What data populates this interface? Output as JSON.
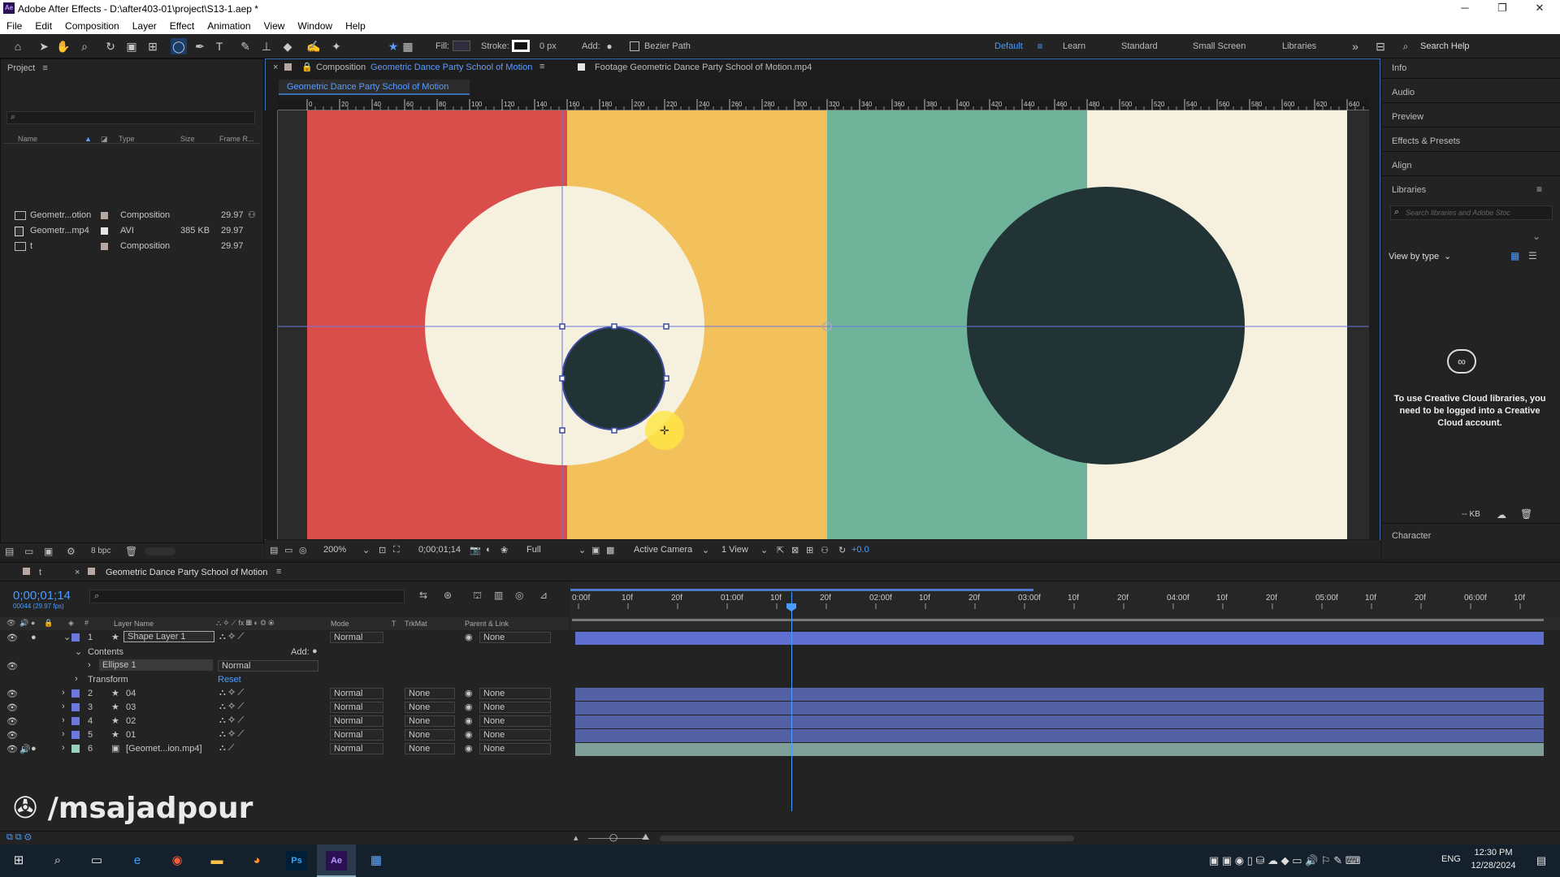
{
  "window": {
    "title": "Adobe After Effects - D:\\after403-01\\project\\S13-1.aep *",
    "logo": "Ae",
    "controls": [
      "─",
      "❐",
      "✕"
    ]
  },
  "menu": [
    "File",
    "Edit",
    "Composition",
    "Layer",
    "Effect",
    "Animation",
    "View",
    "Window",
    "Help"
  ],
  "toolbar": {
    "fill_label": "Fill:",
    "stroke_label": "Stroke:",
    "stroke_px": "0 px",
    "add_label": "Add:",
    "bezier_label": "Bezier Path",
    "workspaces": [
      "Default",
      "Learn",
      "Standard",
      "Small Screen",
      "Libraries"
    ],
    "search_help": "Search Help"
  },
  "project": {
    "title": "Project",
    "columns": [
      "Name",
      "Type",
      "Size",
      "Frame R..."
    ],
    "items": [
      {
        "name": "Geometr...otion",
        "type": "Composition",
        "size": "",
        "fps": "29.97"
      },
      {
        "name": "Geometr...mp4",
        "type": "AVI",
        "size": "385 KB",
        "fps": "29.97"
      },
      {
        "name": "t",
        "type": "Composition",
        "size": "",
        "fps": "29.97"
      }
    ],
    "bpc": "8 bpc"
  },
  "composition": {
    "tab_prefix": "Composition",
    "tab_name": "Geometric Dance Party School of Motion",
    "footage_tab": "Footage Geometric Dance Party School of Motion.mp4",
    "breadcrumb": "Geometric Dance Party School of Motion",
    "ruler_labels": [
      "0",
      "20",
      "40",
      "60",
      "80",
      "100",
      "120",
      "140",
      "160",
      "180",
      "200",
      "220",
      "240",
      "260",
      "280",
      "300",
      "320",
      "340",
      "360",
      "380",
      "400",
      "420",
      "440",
      "460",
      "480",
      "500",
      "520",
      "540",
      "560",
      "580",
      "600",
      "620",
      "640"
    ],
    "zoom": "200%",
    "timecode": "0;00;01;14",
    "resolution": "Full",
    "camera": "Active Camera",
    "view": "1 View",
    "exposure": "+0.0",
    "colors": {
      "red": "#d94d4a",
      "yellow": "#f3c15b",
      "teal": "#6fb39b",
      "cream": "#f6f1df",
      "dark": "#223336"
    }
  },
  "right_panel": {
    "items": [
      "Info",
      "Audio",
      "Preview",
      "Effects & Presets",
      "Align",
      "Libraries"
    ],
    "lib_search_placeholder": "Search libraries and Adobe Stoc",
    "view_by": "View by type",
    "cc_message": "To use Creative Cloud libraries, you need to be logged into a Creative Cloud account.",
    "kb": "-- KB",
    "character": "Character"
  },
  "timeline": {
    "tabs": [
      "t",
      "Geometric Dance Party School of Motion"
    ],
    "timecode": "0;00;01;14",
    "fps_info": "00044 (29.97 fps)",
    "columns": {
      "layer_name": "Layer Name",
      "mode": "Mode",
      "t": "T",
      "trkmat": "TrkMat",
      "parent": "Parent & Link"
    },
    "ruler": [
      "0:00f",
      "10f",
      "20f",
      "01:00f",
      "10f",
      "20f",
      "02:00f",
      "10f",
      "20f",
      "03:00f",
      "10f",
      "20f",
      "04:00f",
      "10f",
      "20f",
      "05:00f",
      "10f",
      "20f",
      "06:00f",
      "10f"
    ],
    "layers": [
      {
        "num": "1",
        "name": "Shape Layer 1",
        "mode": "Normal",
        "trkmat": "",
        "parent": "None",
        "color": "#6a78e0"
      },
      {
        "num": "2",
        "name": "04",
        "mode": "Normal",
        "trkmat": "None",
        "parent": "None",
        "color": "#6a78e0"
      },
      {
        "num": "3",
        "name": "03",
        "mode": "Normal",
        "trkmat": "None",
        "parent": "None",
        "color": "#6a78e0"
      },
      {
        "num": "4",
        "name": "02",
        "mode": "Normal",
        "trkmat": "None",
        "parent": "None",
        "color": "#6a78e0"
      },
      {
        "num": "5",
        "name": "01",
        "mode": "Normal",
        "trkmat": "None",
        "parent": "None",
        "color": "#6a78e0"
      },
      {
        "num": "6",
        "name": "[Geomet...ion.mp4]",
        "mode": "Normal",
        "trkmat": "None",
        "parent": "None",
        "color": "#9ad0c0"
      }
    ],
    "contents_label": "Contents",
    "add_label": "Add:",
    "ellipse_label": "Ellipse 1",
    "ellipse_mode": "Normal",
    "transform_label": "Transform",
    "reset_label": "Reset"
  },
  "watermark": "/msajadpour",
  "taskbar": {
    "time": "12:30 PM",
    "date": "12/28/2024",
    "lang": "ENG"
  }
}
